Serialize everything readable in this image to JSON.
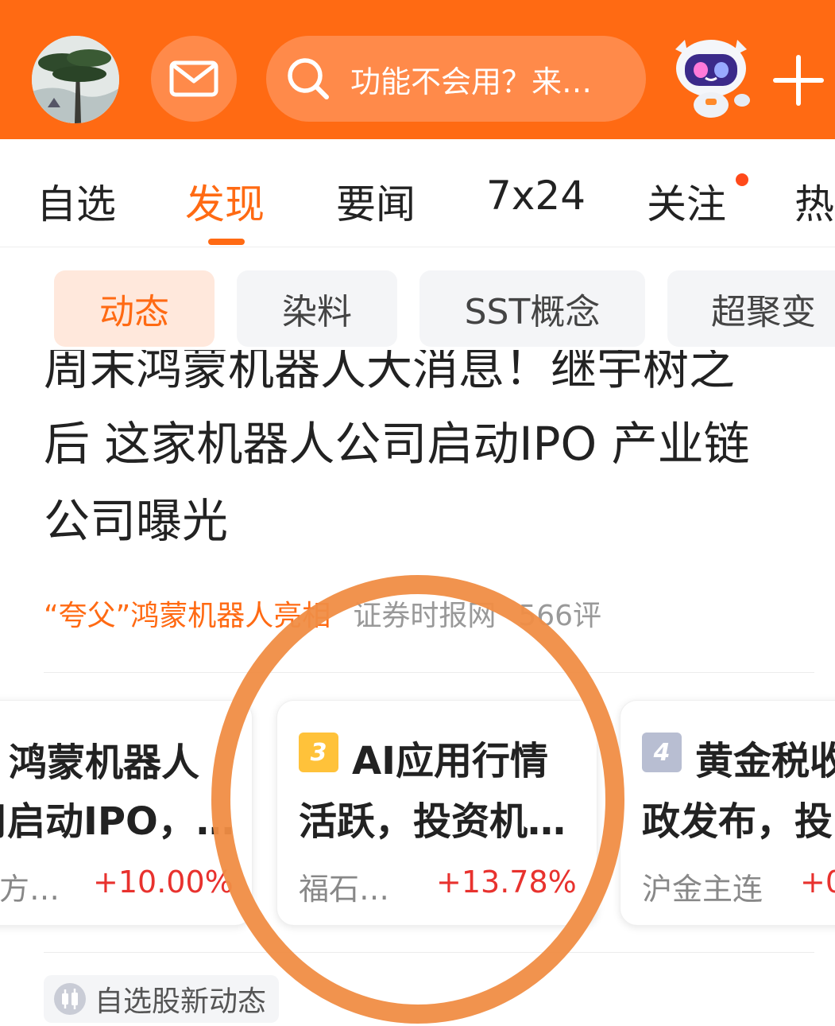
{
  "colors": {
    "brand": "#ff6a13",
    "up": "#e8322e",
    "rank3": "#ffc23a",
    "rank4": "#b8bed2",
    "annotation": "#f08d45"
  },
  "header": {
    "avatar_icon": "tree-avatar",
    "mail_icon": "mail-icon",
    "search_placeholder": "功能不会用？来…",
    "assistant_icon": "robot-mascot",
    "add_icon": "plus-icon"
  },
  "tabs": [
    {
      "label": "自选",
      "active": false
    },
    {
      "label": "发现",
      "active": true
    },
    {
      "label": "要闻",
      "active": false
    },
    {
      "label": "7x24",
      "active": false
    },
    {
      "label": "关注",
      "active": false,
      "badge_dot": true
    },
    {
      "label": "热",
      "active": false
    }
  ],
  "chips": [
    {
      "label": "动态",
      "active": true
    },
    {
      "label": "染料",
      "active": false
    },
    {
      "label": "SST概念",
      "active": false
    },
    {
      "label": "超聚变",
      "active": false
    }
  ],
  "article": {
    "headline_lines": [
      "周末鸿蒙机器人大消息！继宇树之",
      "后 这家机器人公司启动IPO 产业链",
      "公司曝光"
    ],
    "topic": "“夸父”鸿蒙机器人亮相",
    "source": "证券时报网",
    "comments": "566评"
  },
  "hot_cards": [
    {
      "title1": "鸿蒙机器人",
      "title2": "司启动IPO，…",
      "stock": "方…",
      "change": "+10.00%"
    },
    {
      "rank": "3",
      "title1": "AI应用行情",
      "title2": "活跃，投资机…",
      "stock": "福石…",
      "change": "+13.78%"
    },
    {
      "rank": "4",
      "title1": "黄金税收",
      "title2": "政发布，投",
      "stock": "沪金主连",
      "change": "+0"
    }
  ],
  "watch_chip": {
    "label": "自选股新动态",
    "icon": "candlestick-icon"
  }
}
